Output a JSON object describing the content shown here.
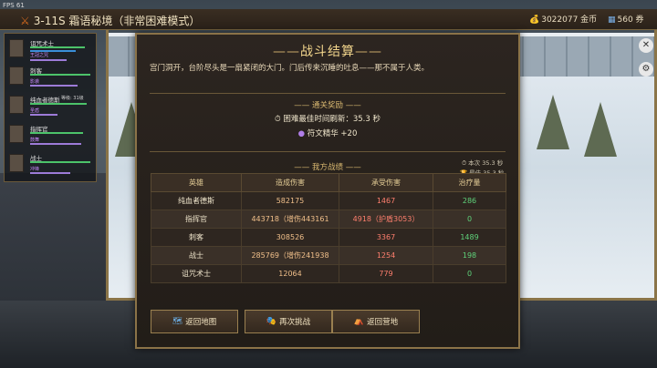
{
  "fps": "FPS 61",
  "stage": {
    "icon": "crossed-swords-icon",
    "title": "3-11S 霜语秘境（非常困难模式）"
  },
  "resources": {
    "gold": {
      "icon": "coin-bag-icon",
      "text": "3022077 金币"
    },
    "tickets": {
      "icon": "ticket-icon",
      "text": "560 券"
    }
  },
  "team": [
    {
      "name": "诅咒术士",
      "skill": "王冠之咒",
      "level": ""
    },
    {
      "name": "刺客",
      "skill": "影袭",
      "level": ""
    },
    {
      "name": "纯血者德斯",
      "skill": "圣盾",
      "level": "等级: 31级"
    },
    {
      "name": "指挥官",
      "skill": "鼓舞",
      "level": ""
    },
    {
      "name": "战士",
      "skill": "冲锋",
      "level": ""
    }
  ],
  "result": {
    "title": "战斗结算",
    "description": "宫门洞开，台阶尽头是一扇紧闭的大门。门后传来沉睡的吐息——那不属于人类。",
    "rewards_header": "通关奖励",
    "best_time": "困难最佳时间刷新：35.3 秒",
    "rune": "符文精华 +20",
    "stats_header": "我方战绩",
    "this_time": "本次 35.3 秒",
    "best": "最佳 35.3 秒",
    "columns": [
      "英雄",
      "造成伤害",
      "承受伤害",
      "治疗量"
    ],
    "rows": [
      [
        "纯血者德斯",
        "582175",
        "1467",
        "286"
      ],
      [
        "指挥官",
        "443718（增伤443161",
        "4918（护盾3053）",
        "0"
      ],
      [
        "刺客",
        "308526",
        "3367",
        "1489"
      ],
      [
        "战士",
        "285769（增伤241938",
        "1254",
        "198"
      ],
      [
        "诅咒术士",
        "12064",
        "779",
        "0"
      ]
    ]
  },
  "buttons": {
    "map": {
      "label": "返回地图",
      "icon": "map-icon"
    },
    "retry": {
      "label": "再次挑战",
      "icon": "masks-icon"
    },
    "camp": {
      "label": "返回营地",
      "icon": "tent-icon"
    }
  }
}
